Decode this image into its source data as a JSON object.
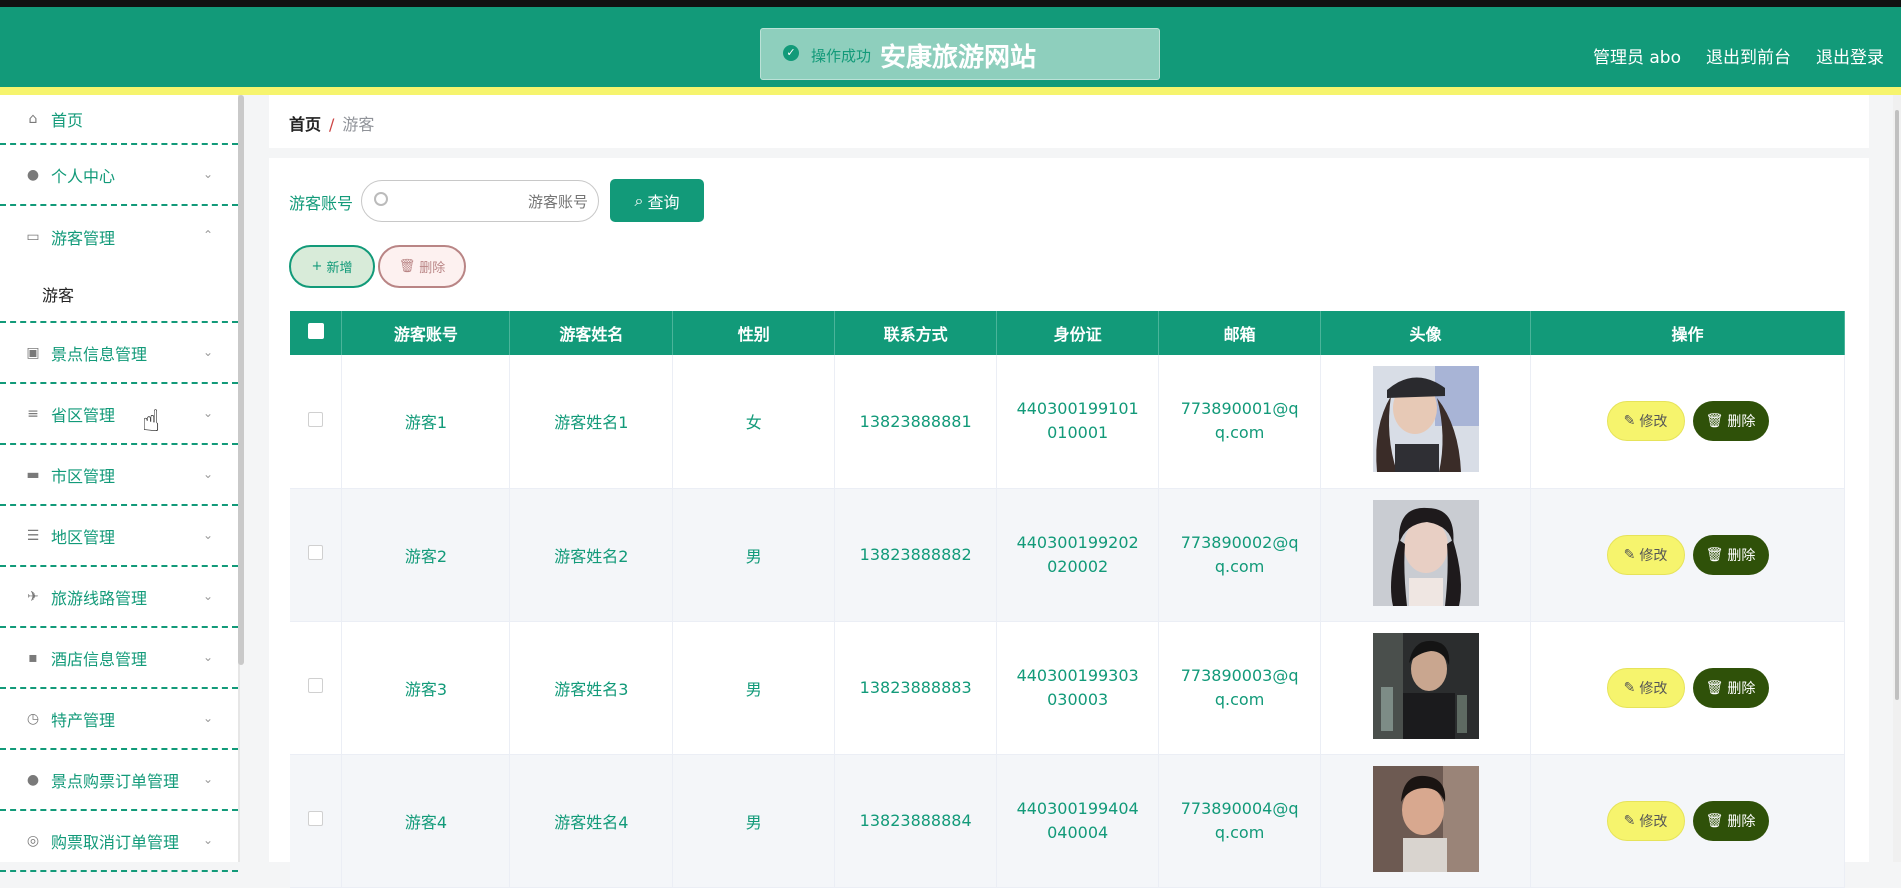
{
  "header": {
    "site_title": "安康旅游网站",
    "toast": "操作成功",
    "admin": "管理员 abo",
    "front_link": "退出到前台",
    "logout": "退出登录"
  },
  "sidebar": {
    "home": "首页",
    "items": [
      {
        "label": "个人中心",
        "icon": "user-icon"
      },
      {
        "label": "游客管理",
        "icon": "id-card-icon",
        "open": true
      },
      {
        "label": "景点信息管理",
        "icon": "clipboard-icon"
      },
      {
        "label": "省区管理",
        "icon": "list-icon"
      },
      {
        "label": "市区管理",
        "icon": "monitor-icon"
      },
      {
        "label": "地区管理",
        "icon": "sliders-icon"
      },
      {
        "label": "旅游线路管理",
        "icon": "route-icon"
      },
      {
        "label": "酒店信息管理",
        "icon": "chat-icon"
      },
      {
        "label": "特产管理",
        "icon": "clock-icon"
      },
      {
        "label": "景点购票订单管理",
        "icon": "user-icon"
      },
      {
        "label": "购票取消订单管理",
        "icon": "basketball-icon"
      }
    ],
    "submenu": "游客"
  },
  "breadcrumb": {
    "home": "首页",
    "sep": "/",
    "current": "游客"
  },
  "search": {
    "label": "游客账号",
    "placeholder": "游客账号",
    "button": "查询"
  },
  "actions": {
    "add": "新增",
    "delete": "删除"
  },
  "table": {
    "headers": [
      "游客账号",
      "游客姓名",
      "性别",
      "联系方式",
      "身份证",
      "邮箱",
      "头像",
      "操作"
    ],
    "rows": [
      {
        "account": "游客1",
        "name": "游客姓名1",
        "gender": "女",
        "phone": "13823888881",
        "idcard": "440300199101010001",
        "email": "773890001@qq.com"
      },
      {
        "account": "游客2",
        "name": "游客姓名2",
        "gender": "男",
        "phone": "13823888882",
        "idcard": "440300199202020002",
        "email": "773890002@qq.com"
      },
      {
        "account": "游客3",
        "name": "游客姓名3",
        "gender": "男",
        "phone": "13823888883",
        "idcard": "440300199303030003",
        "email": "773890003@qq.com"
      },
      {
        "account": "游客4",
        "name": "游客姓名4",
        "gender": "男",
        "phone": "13823888884",
        "idcard": "440300199404040004",
        "email": "773890004@qq.com"
      }
    ],
    "edit_label": "修改",
    "delete_label": "删除"
  },
  "colors": {
    "primary": "#129a79",
    "accent": "#f6f46d",
    "danger_dark": "#2f5109"
  }
}
